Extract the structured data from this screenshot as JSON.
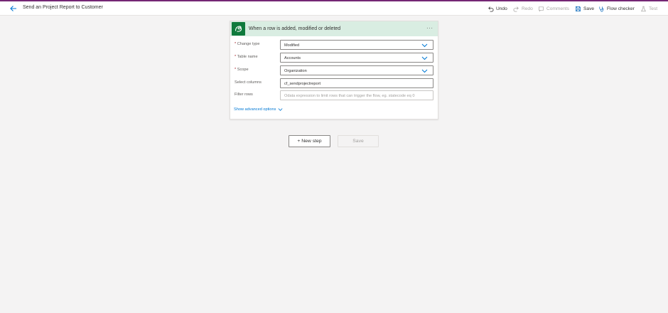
{
  "header": {
    "title": "Send an Project Report to Customer",
    "commands": {
      "undo": "Undo",
      "redo": "Redo",
      "comments": "Comments",
      "save": "Save",
      "flow_checker": "Flow checker",
      "test": "Test"
    }
  },
  "trigger": {
    "title": "When a row is added, modified or deleted",
    "icon": "dataverse-icon",
    "menu": "···",
    "fields": [
      {
        "label": "Change type",
        "required": "*",
        "value": "Modified"
      },
      {
        "label": "Table name",
        "required": "*",
        "value": "Accounts"
      },
      {
        "label": "Scope",
        "required": "*",
        "value": "Organization"
      },
      {
        "label": "Select columns",
        "value": "cf_sendprojectreport"
      },
      {
        "label": "Filter rows",
        "placeholder": "Odata expression to limit rows that can trigger the flow, eg. statecode eq 0"
      }
    ],
    "advanced": "Show advanced options"
  },
  "actions": {
    "new_step": "+ New step",
    "save": "Save"
  },
  "colors": {
    "accent": "#742774",
    "connector": "#0f7a3c",
    "header_bg": "#d9ede2",
    "link": "#0078d4"
  }
}
